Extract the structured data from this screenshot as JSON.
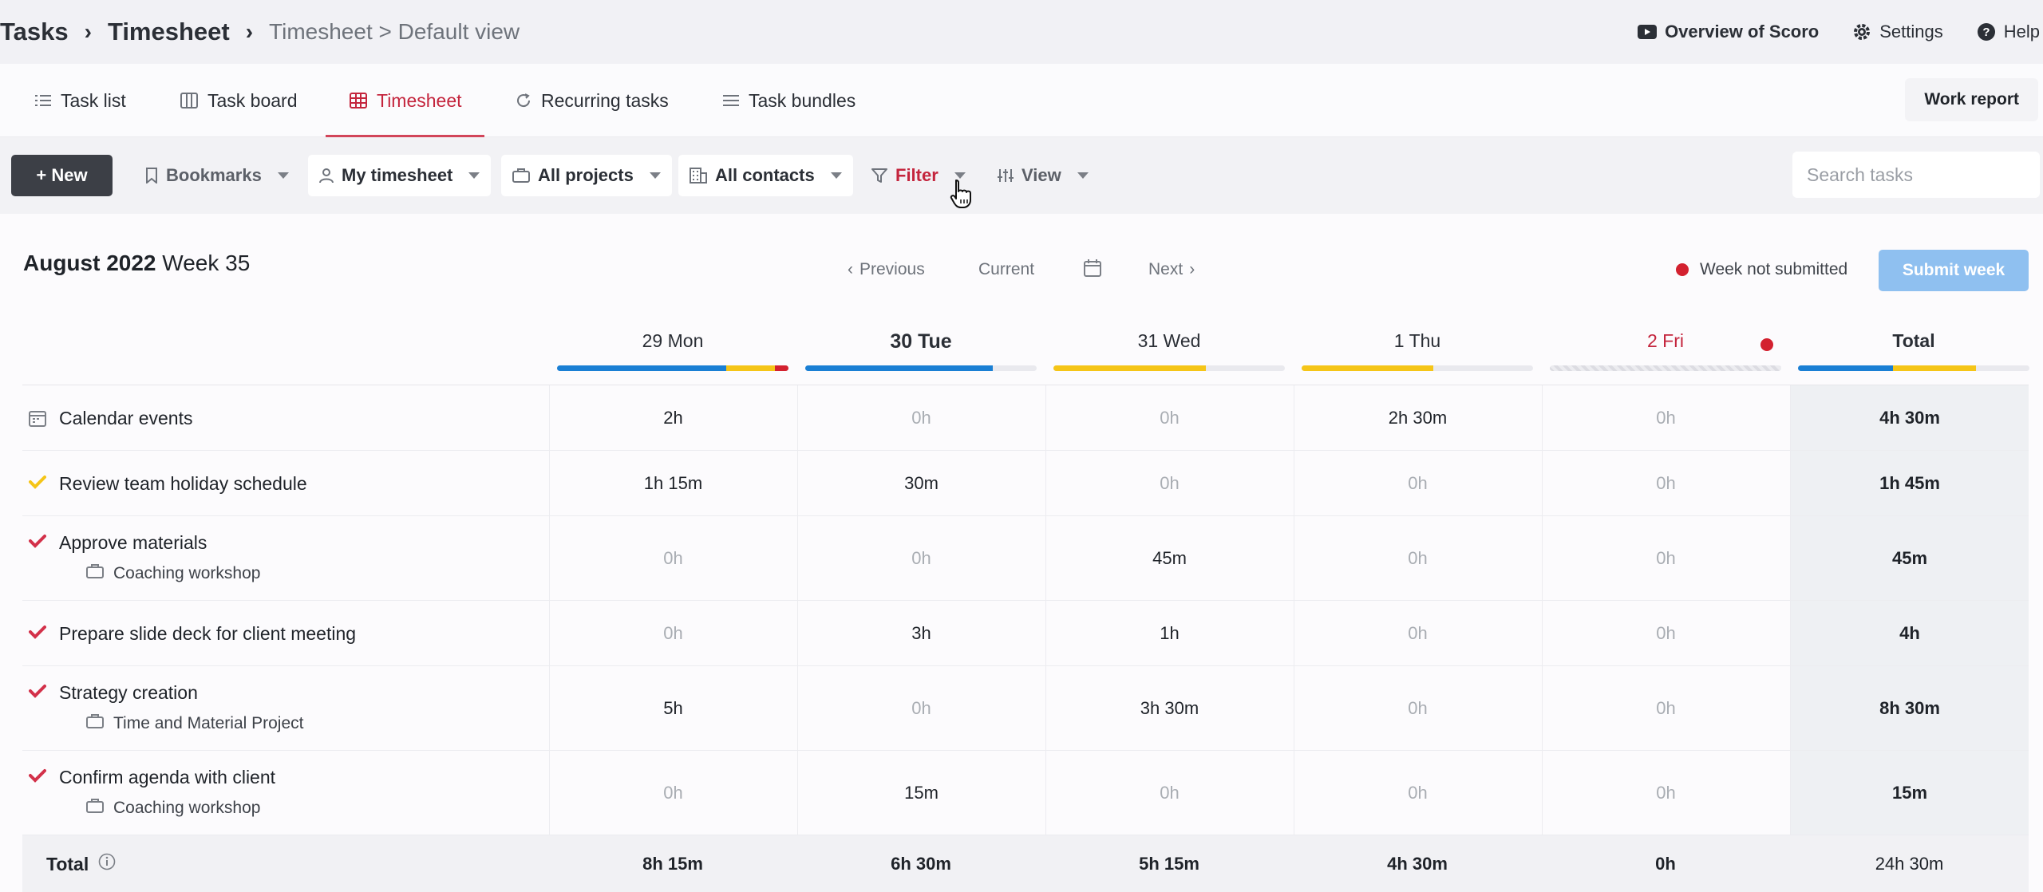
{
  "breadcrumb": {
    "root": "Tasks",
    "module": "Timesheet",
    "view": "Timesheet > Default view",
    "separator": "›"
  },
  "header_links": {
    "overview": "Overview of Scoro",
    "settings": "Settings",
    "help": "Help"
  },
  "tabs": [
    {
      "label": "Task list",
      "icon": "list-icon"
    },
    {
      "label": "Task board",
      "icon": "board-icon"
    },
    {
      "label": "Timesheet",
      "icon": "grid-icon",
      "active": true
    },
    {
      "label": "Recurring tasks",
      "icon": "refresh-icon"
    },
    {
      "label": "Task bundles",
      "icon": "bundle-icon"
    }
  ],
  "work_report": "Work report",
  "toolbar": {
    "new_label": "+ New",
    "bookmarks": "Bookmarks",
    "timesheet_select": "My timesheet",
    "projects_select": "All projects",
    "contacts_select": "All contacts",
    "filter": "Filter",
    "view": "View",
    "search_placeholder": "Search tasks"
  },
  "week": {
    "month": "August 2022",
    "week": "Week 35",
    "previous": "Previous",
    "current": "Current",
    "next": "Next",
    "status": "Week not submitted",
    "submit": "Submit week"
  },
  "colors": {
    "blue": "#1a7fd4",
    "yellow": "#f5c518",
    "red": "#d3212f",
    "accent": "#c4253d"
  },
  "days": [
    {
      "label": "29 Mon",
      "segments": [
        {
          "color": "#1a7fd4",
          "frac": 0.73
        },
        {
          "color": "#f5c518",
          "frac": 0.21
        },
        {
          "color": "#d3212f",
          "frac": 0.06
        }
      ]
    },
    {
      "label": "30 Tue",
      "bold": true,
      "segments": [
        {
          "color": "#1a7fd4",
          "frac": 0.81
        }
      ]
    },
    {
      "label": "31 Wed",
      "segments": [
        {
          "color": "#f5c518",
          "frac": 0.66
        }
      ]
    },
    {
      "label": "1 Thu",
      "segments": [
        {
          "color": "#f5c518",
          "frac": 0.57
        }
      ]
    },
    {
      "label": "2 Fri",
      "red": true,
      "hatched": true,
      "segments": []
    },
    {
      "label": "Total",
      "bold": true,
      "segments": [
        {
          "color": "#1a7fd4",
          "frac": 0.41
        },
        {
          "color": "#f5c518",
          "frac": 0.36
        }
      ]
    }
  ],
  "rows": [
    {
      "name": "Calendar events",
      "icon": "calendar-icon",
      "values": [
        "2h",
        "0h",
        "0h",
        "2h 30m",
        "0h"
      ],
      "total": "4h 30m"
    },
    {
      "name": "Review team holiday schedule",
      "icon": "check-yellow-icon",
      "values": [
        "1h 15m",
        "30m",
        "0h",
        "0h",
        "0h"
      ],
      "total": "1h 45m"
    },
    {
      "name": "Approve materials",
      "project": "Coaching workshop",
      "icon": "check-red-icon",
      "values": [
        "0h",
        "0h",
        "45m",
        "0h",
        "0h"
      ],
      "total": "45m"
    },
    {
      "name": "Prepare slide deck for client meeting",
      "icon": "check-red-icon",
      "values": [
        "0h",
        "3h",
        "1h",
        "0h",
        "0h"
      ],
      "total": "4h"
    },
    {
      "name": "Strategy creation",
      "project": "Time and Material Project",
      "icon": "check-red-icon",
      "values": [
        "5h",
        "0h",
        "3h 30m",
        "0h",
        "0h"
      ],
      "total": "8h 30m"
    },
    {
      "name": "Confirm agenda with client",
      "project": "Coaching workshop",
      "icon": "check-red-icon",
      "values": [
        "0h",
        "15m",
        "0h",
        "0h",
        "0h"
      ],
      "total": "15m"
    }
  ],
  "totals": {
    "label": "Total",
    "values": [
      "8h 15m",
      "6h 30m",
      "5h 15m",
      "4h 30m",
      "0h"
    ],
    "grand": "24h 30m"
  }
}
